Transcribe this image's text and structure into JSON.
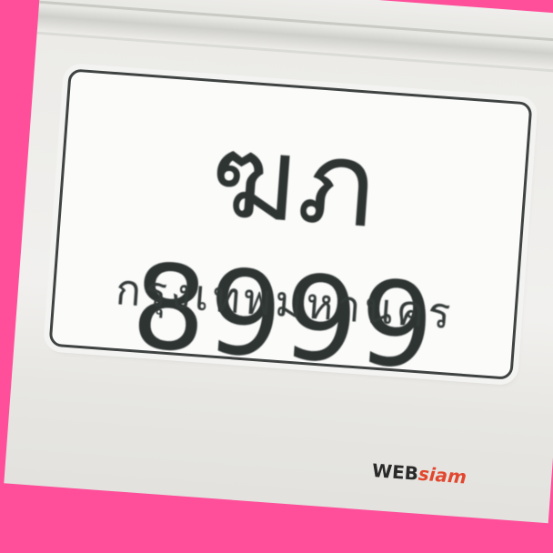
{
  "plate": {
    "number": "ฆภ 8999",
    "province": "กรุงเทพมหานคร"
  },
  "watermark": {
    "part1": "WEB",
    "part2": "siam"
  },
  "colors": {
    "border": "#ff4f9a",
    "plate_background": "#fbfbfa",
    "text": "#2d3432"
  }
}
